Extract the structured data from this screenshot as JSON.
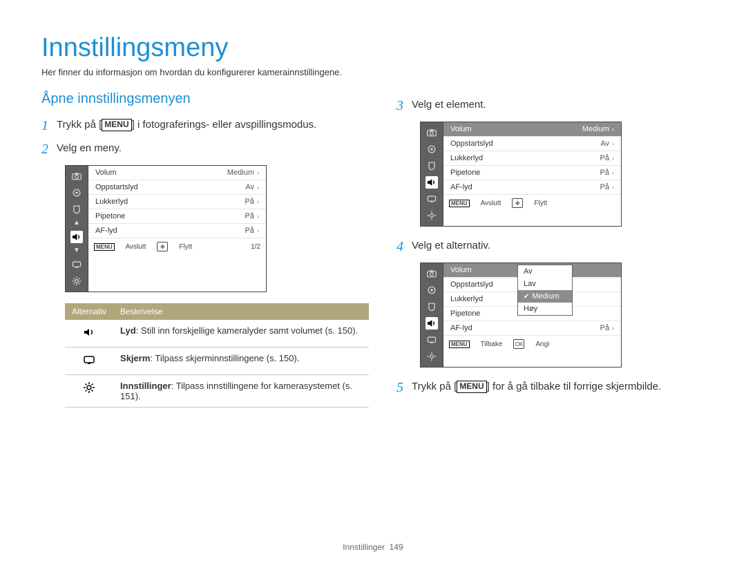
{
  "page_title": "Innstillingsmeny",
  "intro": "Her finner du informasjon om hvordan du konfigurerer kamerainnstillingene.",
  "subhead": "Åpne innstillingsmenyen",
  "menu_label": "MENU",
  "steps": {
    "s1a": "Trykk på [",
    "s1b": "] i fotograferings- eller avspillingsmodus.",
    "s2": "Velg en meny.",
    "s3": "Velg et element.",
    "s4": "Velg et alternativ.",
    "s5a": "Trykk på [",
    "s5b": "] for å gå tilbake til forrige skjermbilde."
  },
  "shot_rows": [
    {
      "label": "Volum",
      "value": "Medium"
    },
    {
      "label": "Oppstartslyd",
      "value": "Av"
    },
    {
      "label": "Lukkerlyd",
      "value": "På"
    },
    {
      "label": "Pipetone",
      "value": "På"
    },
    {
      "label": "AF-lyd",
      "value": "På"
    }
  ],
  "shot_footer": {
    "exit": "Avslutt",
    "move": "Flytt",
    "back": "Tilbake",
    "set": "Angi",
    "page": "1/2"
  },
  "popup_opts": [
    "Av",
    "Lav",
    "Medium",
    "Høy"
  ],
  "table": {
    "h1": "Alternativ",
    "h2": "Beskrivelse",
    "rows": [
      {
        "title": "Lyd",
        "text": ": Still inn forskjellige kameralyder samt volumet (s. 150)."
      },
      {
        "title": "Skjerm",
        "text": ": Tilpass skjerminnstillingene (s. 150)."
      },
      {
        "title": "Innstillinger",
        "text": ": Tilpass innstillingene for kamerasystemet (s. 151)."
      }
    ]
  },
  "footer": {
    "section": "Innstillinger",
    "page": "149"
  }
}
